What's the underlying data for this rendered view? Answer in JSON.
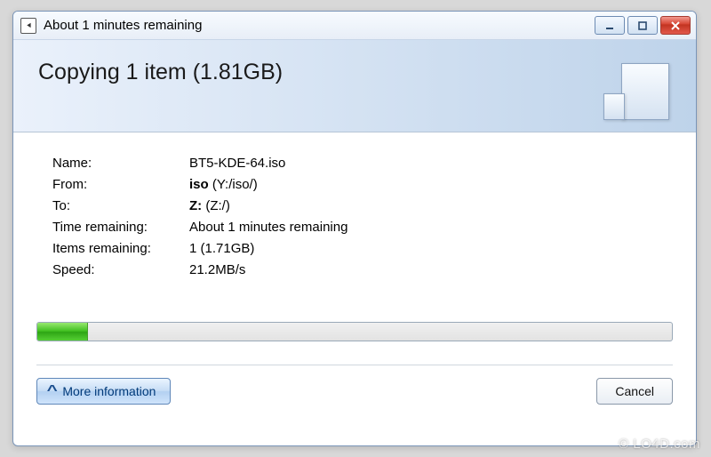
{
  "window": {
    "title": "About 1 minutes remaining"
  },
  "header": {
    "title": "Copying 1 item (1.81GB)"
  },
  "details": {
    "name": {
      "label": "Name:",
      "value": "BT5-KDE-64.iso"
    },
    "from": {
      "label": "From:",
      "bold": "iso",
      "suffix": " (Y:/iso/)"
    },
    "to": {
      "label": "To:",
      "bold": "Z:",
      "suffix": " (Z:/)"
    },
    "time": {
      "label": "Time remaining:",
      "value": "About 1 minutes remaining"
    },
    "items": {
      "label": "Items remaining:",
      "value": "1 (1.71GB)"
    },
    "speed": {
      "label": "Speed:",
      "value": "21.2MB/s"
    }
  },
  "progress": {
    "percent": 8
  },
  "buttons": {
    "more_info": "More information",
    "cancel": "Cancel"
  },
  "watermark": "© LO4D.com"
}
